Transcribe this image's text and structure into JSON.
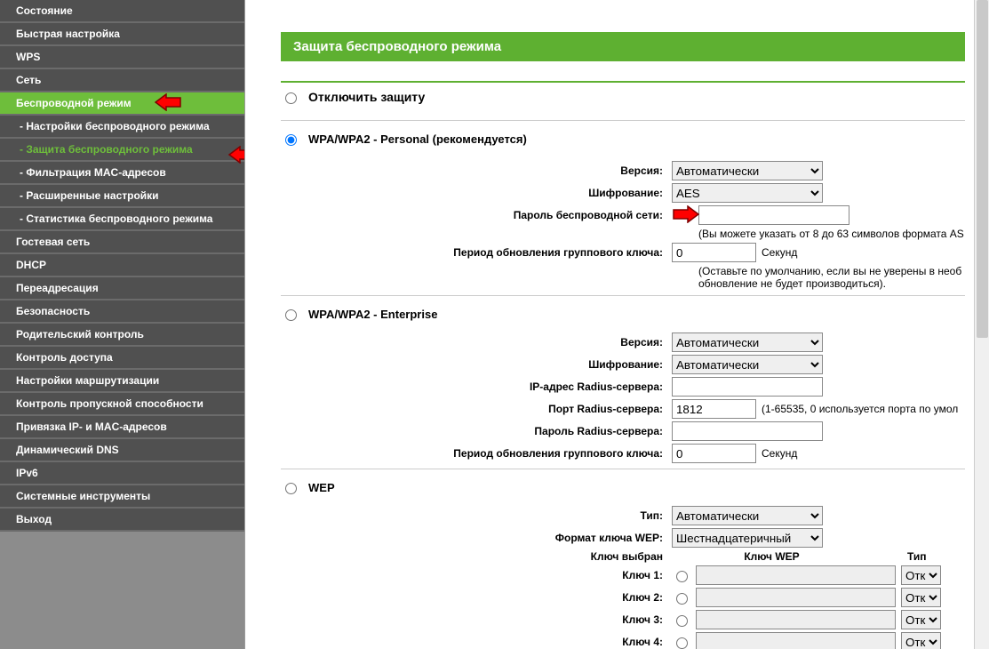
{
  "sidebar": {
    "items": [
      {
        "label": "Состояние",
        "kind": "top"
      },
      {
        "label": "Быстрая настройка",
        "kind": "top"
      },
      {
        "label": "WPS",
        "kind": "top"
      },
      {
        "label": "Сеть",
        "kind": "top"
      },
      {
        "label": "Беспроводной режим",
        "kind": "top",
        "active": true,
        "arrow": true
      },
      {
        "label": "- Настройки беспроводного режима",
        "kind": "sub"
      },
      {
        "label": "- Защита беспроводного режима",
        "kind": "sub",
        "subactive": true,
        "arrow": true
      },
      {
        "label": "- Фильтрация MAC-адресов",
        "kind": "sub"
      },
      {
        "label": "- Расширенные настройки",
        "kind": "sub"
      },
      {
        "label": "- Статистика беспроводного режима",
        "kind": "sub"
      },
      {
        "label": "Гостевая сеть",
        "kind": "top"
      },
      {
        "label": "DHCP",
        "kind": "top"
      },
      {
        "label": "Переадресация",
        "kind": "top"
      },
      {
        "label": "Безопасность",
        "kind": "top"
      },
      {
        "label": "Родительский контроль",
        "kind": "top"
      },
      {
        "label": "Контроль доступа",
        "kind": "top"
      },
      {
        "label": "Настройки маршрутизации",
        "kind": "top"
      },
      {
        "label": "Контроль пропускной способности",
        "kind": "top"
      },
      {
        "label": "Привязка IP- и MAC-адресов",
        "kind": "top"
      },
      {
        "label": "Динамический DNS",
        "kind": "top"
      },
      {
        "label": "IPv6",
        "kind": "top"
      },
      {
        "label": "Системные инструменты",
        "kind": "top"
      },
      {
        "label": "Выход",
        "kind": "top"
      }
    ]
  },
  "page": {
    "title": "Защита беспроводного режима",
    "disable_label": "Отключить защиту",
    "personal": {
      "heading": "WPA/WPA2 - Personal (рекомендуется)",
      "version_label": "Версия:",
      "version_value": "Автоматически",
      "enc_label": "Шифрование:",
      "enc_value": "AES",
      "pwd_label": "Пароль беспроводной сети:",
      "pwd_value": "",
      "pwd_note": "(Вы можете указать от 8 до 63 символов формата AS",
      "gk_label": "Период обновления группового ключа:",
      "gk_value": "0",
      "gk_unit": "Секунд",
      "gk_note": "(Оставьте по умолчанию, если вы не уверены в необ обновление не будет производиться)."
    },
    "enterprise": {
      "heading": "WPA/WPA2 - Enterprise",
      "version_label": "Версия:",
      "version_value": "Автоматически",
      "enc_label": "Шифрование:",
      "enc_value": "Автоматически",
      "radius_ip_label": "IP-адрес Radius-сервера:",
      "radius_ip_value": "",
      "radius_port_label": "Порт Radius-сервера:",
      "radius_port_value": "1812",
      "radius_port_note": "(1-65535, 0 используется порта по умол",
      "radius_pwd_label": "Пароль Radius-сервера:",
      "radius_pwd_value": "",
      "gk_label": "Период обновления группового ключа:",
      "gk_value": "0",
      "gk_unit": "Секунд"
    },
    "wep": {
      "heading": "WEP",
      "type_label": "Тип:",
      "type_value": "Автоматически",
      "format_label": "Формат ключа WEP:",
      "format_value": "Шестнадцатеричный",
      "selected_label": "Ключ выбран",
      "col_key": "Ключ WEP",
      "col_type": "Тип",
      "rows": [
        {
          "label": "Ключ 1:",
          "type": "Отк"
        },
        {
          "label": "Ключ 2:",
          "type": "Отк"
        },
        {
          "label": "Ключ 3:",
          "type": "Отк"
        },
        {
          "label": "Ключ 4:",
          "type": "Отк"
        }
      ]
    }
  }
}
